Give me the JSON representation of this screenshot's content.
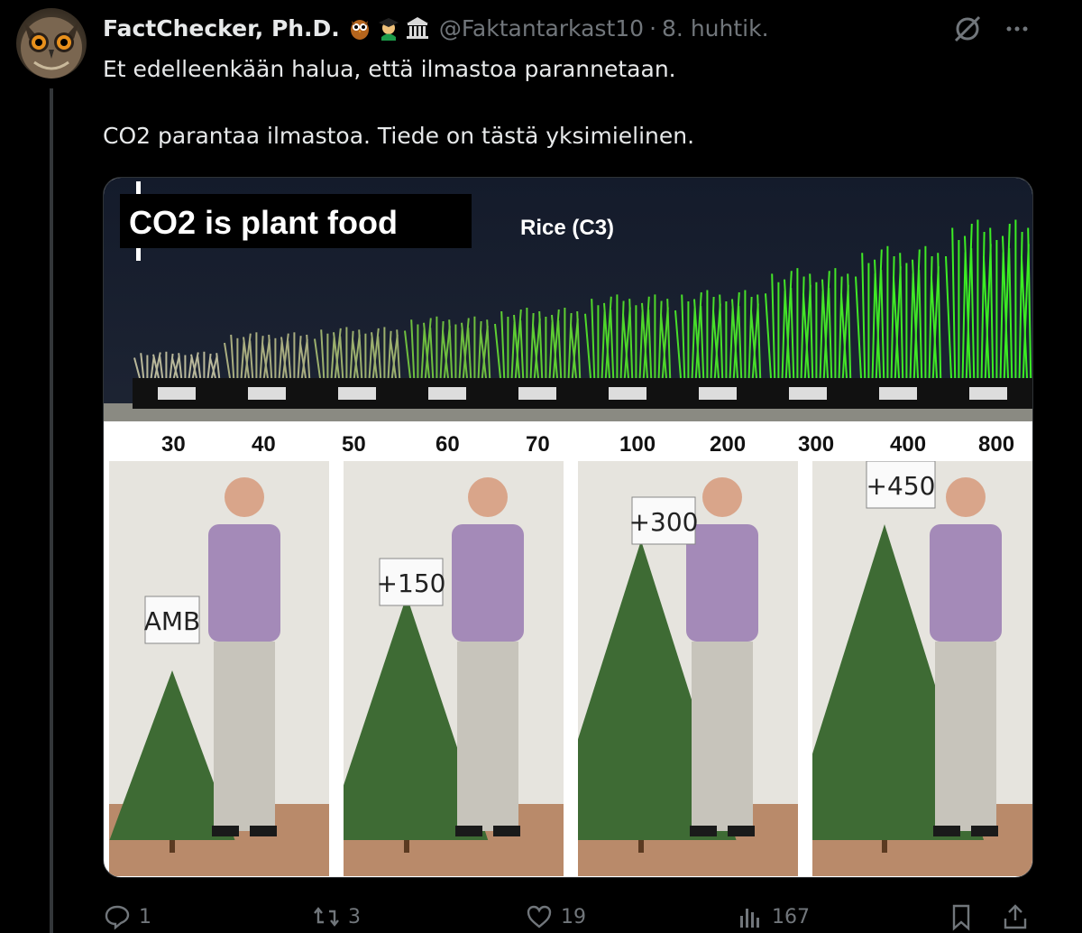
{
  "post": {
    "author_name": "FactChecker, Ph.D.",
    "handle": "@Faktantarkast10",
    "separator": "·",
    "date": "8. huhtik.",
    "text_line1": "Et edelleenkään halua, että ilmastoa parannetaan.",
    "text_line2": "CO2 parantaa ilmastoa. Tiede on tästä yksimielinen.",
    "badges": [
      "owl-emoji",
      "graduate-emoji",
      "classical-building-emoji"
    ]
  },
  "media": {
    "caption": "CO2 is plant food",
    "rice_label": "Rice (C3)",
    "ppm_labels": [
      "30",
      "40",
      "50",
      "60",
      "70",
      "100",
      "200",
      "300",
      "400",
      "800"
    ],
    "sign_labels": [
      "AMB",
      "+150",
      "+300",
      "+450"
    ]
  },
  "actions": {
    "reply_count": "1",
    "repost_count": "3",
    "like_count": "19",
    "view_count": "167"
  },
  "colors": {
    "background": "#000000",
    "text_primary": "#e7e9ea",
    "text_secondary": "#71767b",
    "border": "#2f3336"
  }
}
